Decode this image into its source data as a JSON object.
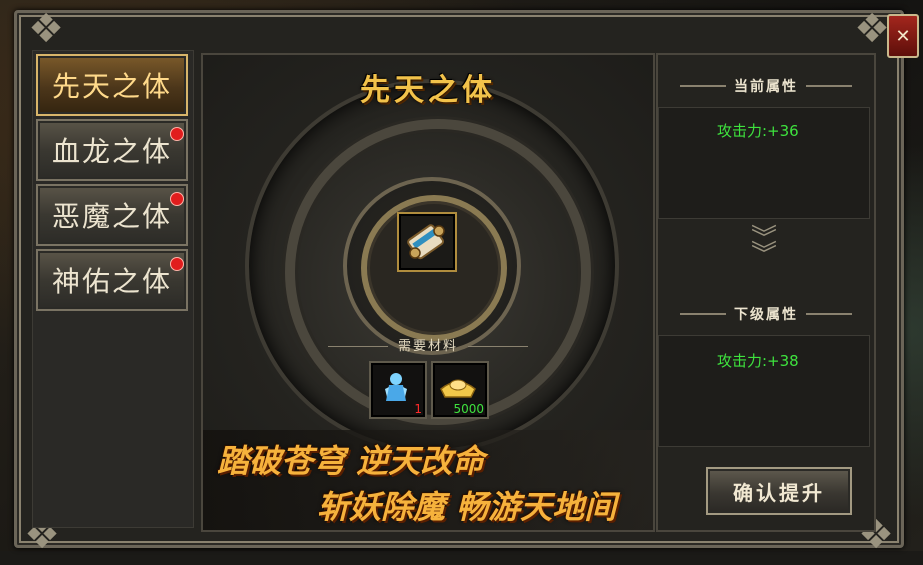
{
  "tabs": [
    {
      "label": "先天之体",
      "active": true,
      "badge": false
    },
    {
      "label": "血龙之体",
      "active": false,
      "badge": true
    },
    {
      "label": "恶魔之体",
      "active": false,
      "badge": true
    },
    {
      "label": "神佑之体",
      "active": false,
      "badge": true
    }
  ],
  "center": {
    "title": "先天之体",
    "main_item_icon": "scroll-icon",
    "materials_label": "需要材料",
    "materials": [
      {
        "icon": "crystal-figure-icon",
        "count": "1",
        "count_color": "#ff2a2a"
      },
      {
        "icon": "gold-ingot-icon",
        "count": "5000",
        "count_color": "#3ee23e"
      }
    ],
    "slogan_line1": "踏破苍穹  逆天改命",
    "slogan_line2": "斩妖除魔  畅游天地间"
  },
  "right": {
    "current_header": "当前属性",
    "current_attr": "攻击力:+36",
    "next_header": "下级属性",
    "next_attr": "攻击力:+38",
    "arrow_icon": "double-chevron-down-icon"
  },
  "confirm_label": "确认提升",
  "close_icon": "close-icon",
  "colors": {
    "accent_gold": "#f2c24a",
    "attr_green": "#3ee23e",
    "badge_red": "#e11d1d"
  }
}
